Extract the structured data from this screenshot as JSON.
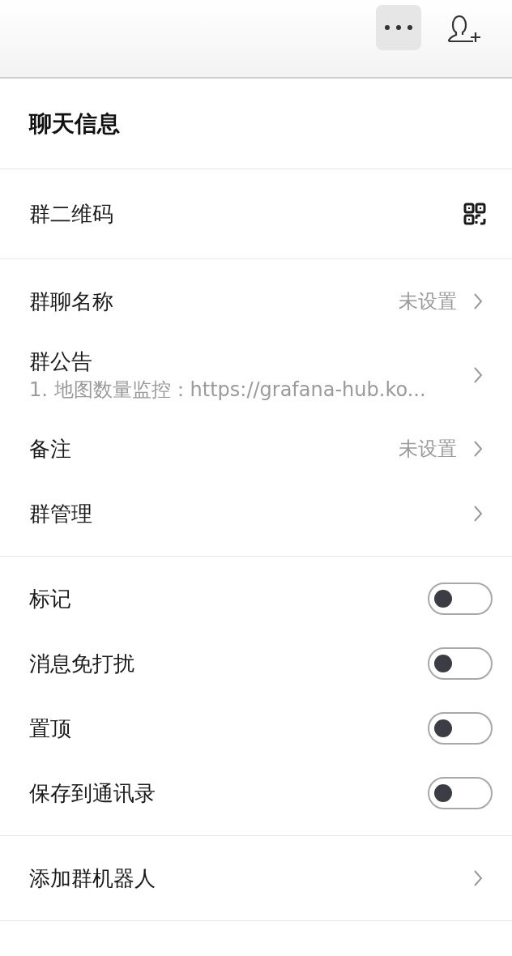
{
  "title": "聊天信息",
  "sections": [
    {
      "items": [
        {
          "kind": "qr",
          "label": "群二维码"
        }
      ]
    },
    {
      "items": [
        {
          "kind": "link",
          "label": "群聊名称",
          "value": "未设置"
        },
        {
          "kind": "link",
          "label": "群公告",
          "subtitle": "1. 地图数量监控：https://grafana-hub.ko..."
        },
        {
          "kind": "link",
          "label": "备注",
          "value": "未设置"
        },
        {
          "kind": "link",
          "label": "群管理"
        }
      ]
    },
    {
      "items": [
        {
          "kind": "toggle",
          "label": "标记",
          "on": false
        },
        {
          "kind": "toggle",
          "label": "消息免打扰",
          "on": false
        },
        {
          "kind": "toggle",
          "label": "置顶",
          "on": false
        },
        {
          "kind": "toggle",
          "label": "保存到通讯录",
          "on": false
        }
      ]
    },
    {
      "items": [
        {
          "kind": "link",
          "label": "添加群机器人"
        }
      ]
    }
  ]
}
